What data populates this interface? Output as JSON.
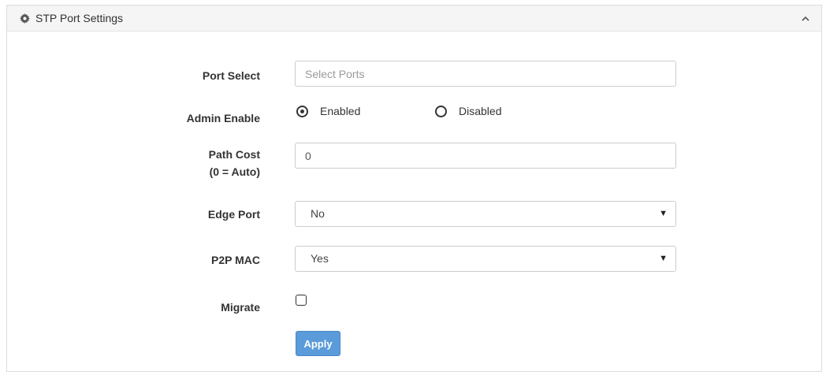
{
  "panel": {
    "title": "STP Port Settings",
    "icon": "gear-icon",
    "collapse_icon": "chevron-up-icon"
  },
  "form": {
    "port_select": {
      "label": "Port Select",
      "placeholder": "Select Ports",
      "value": ""
    },
    "admin_enable": {
      "label": "Admin Enable",
      "options": [
        "Enabled",
        "Disabled"
      ],
      "selected": "Enabled"
    },
    "path_cost": {
      "label_line1": "Path Cost",
      "label_line2": "(0 = Auto)",
      "value": "0"
    },
    "edge_port": {
      "label": "Edge Port",
      "selected": "No"
    },
    "p2p_mac": {
      "label": "P2P MAC",
      "selected": "Yes"
    },
    "migrate": {
      "label": "Migrate",
      "checked": false
    },
    "apply_label": "Apply"
  },
  "colors": {
    "apply_button": "#5b9bd9",
    "header_bg": "#f5f5f5"
  }
}
